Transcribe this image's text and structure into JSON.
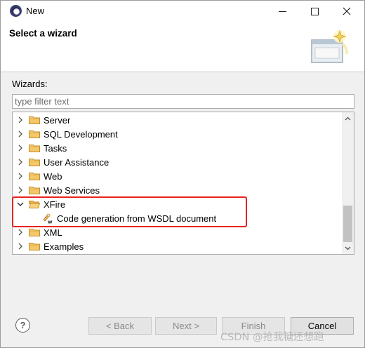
{
  "window": {
    "title": "New",
    "icon": "eclipse-icon"
  },
  "header": {
    "title": "Select a wizard",
    "graphic_icon": "wizard-banner-icon"
  },
  "wizards": {
    "label": "Wizards:",
    "filter_placeholder": "type filter text",
    "filter_value": ""
  },
  "tree": {
    "items": [
      {
        "label": "Server",
        "expanded": false,
        "icon": "folder-icon"
      },
      {
        "label": "SQL Development",
        "expanded": false,
        "icon": "folder-icon"
      },
      {
        "label": "Tasks",
        "expanded": false,
        "icon": "folder-icon"
      },
      {
        "label": "User Assistance",
        "expanded": false,
        "icon": "folder-icon"
      },
      {
        "label": "Web",
        "expanded": false,
        "icon": "folder-icon"
      },
      {
        "label": "Web Services",
        "expanded": false,
        "icon": "folder-icon"
      },
      {
        "label": "XFire",
        "expanded": true,
        "icon": "folder-open-icon",
        "children": [
          {
            "label": "Code generation from WSDL document",
            "icon": "wsdl-wizard-icon"
          }
        ]
      },
      {
        "label": "XML",
        "expanded": false,
        "icon": "folder-icon"
      },
      {
        "label": "Examples",
        "expanded": false,
        "icon": "folder-icon"
      }
    ],
    "highlight_color": "#e8231f"
  },
  "buttons": {
    "help": "?",
    "back": "< Back",
    "next": "Next >",
    "finish": "Finish",
    "cancel": "Cancel"
  },
  "watermark": "CSDN @抢我糖还想跑"
}
